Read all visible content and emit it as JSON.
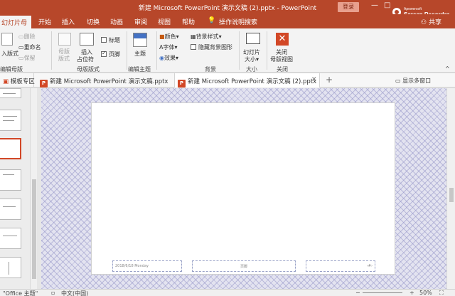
{
  "titlebar": {
    "title": "新建 Microsoft PowerPoint 演示文稿 (2).pptx  -  PowerPoint",
    "login": "登录",
    "minimize": "—",
    "maximize": "□"
  },
  "recorder": {
    "small": "Apowersoft",
    "big": "Screen Recorder"
  },
  "tabs": {
    "slide_master": "幻灯片母版",
    "items": [
      "开始",
      "插入",
      "切换",
      "动画",
      "审阅",
      "视图",
      "帮助"
    ],
    "search": "操作说明搜索",
    "share": "共享"
  },
  "ribbon": {
    "insert_layout": "入版式",
    "delete": "删除",
    "rename": "重命名",
    "preserve": "保留",
    "master_layout": "母版\n版式",
    "insert_placeholder_1": "插入",
    "insert_placeholder_2": "占位符",
    "title_check": "标题",
    "footer_check": "页脚",
    "themes": "主题",
    "colors": "颜色",
    "fonts": "字体",
    "effects": "效果",
    "bg_styles": "背景样式",
    "hide_bg": "隐藏背景图形",
    "slide_size_1": "幻灯片",
    "slide_size_2": "大小",
    "close_1": "关闭",
    "close_2": "母版视图",
    "group_edit_master": "编辑母版",
    "group_master_layout": "母版版式",
    "group_edit_theme": "编辑主题",
    "group_background": "背景",
    "group_size": "大小",
    "group_close": "关闭"
  },
  "doctabs": {
    "template_zone": "模板专区",
    "doc1": "新建 Microsoft PowerPoint 演示文稿.pptx",
    "doc2": "新建 Microsoft PowerPoint 演示文稿 (2).pptx",
    "add": "+",
    "show_multi": "显示多窗口"
  },
  "slide": {
    "date": "2018/6/18 Monday",
    "footer": "页脚",
    "number": "‹#›"
  },
  "statusbar": {
    "theme": "\"Office 主题\"",
    "language": "中文(中国)",
    "zoom": "50%"
  },
  "colors": {
    "accent": "#b7472a",
    "selection": "#d24726"
  }
}
